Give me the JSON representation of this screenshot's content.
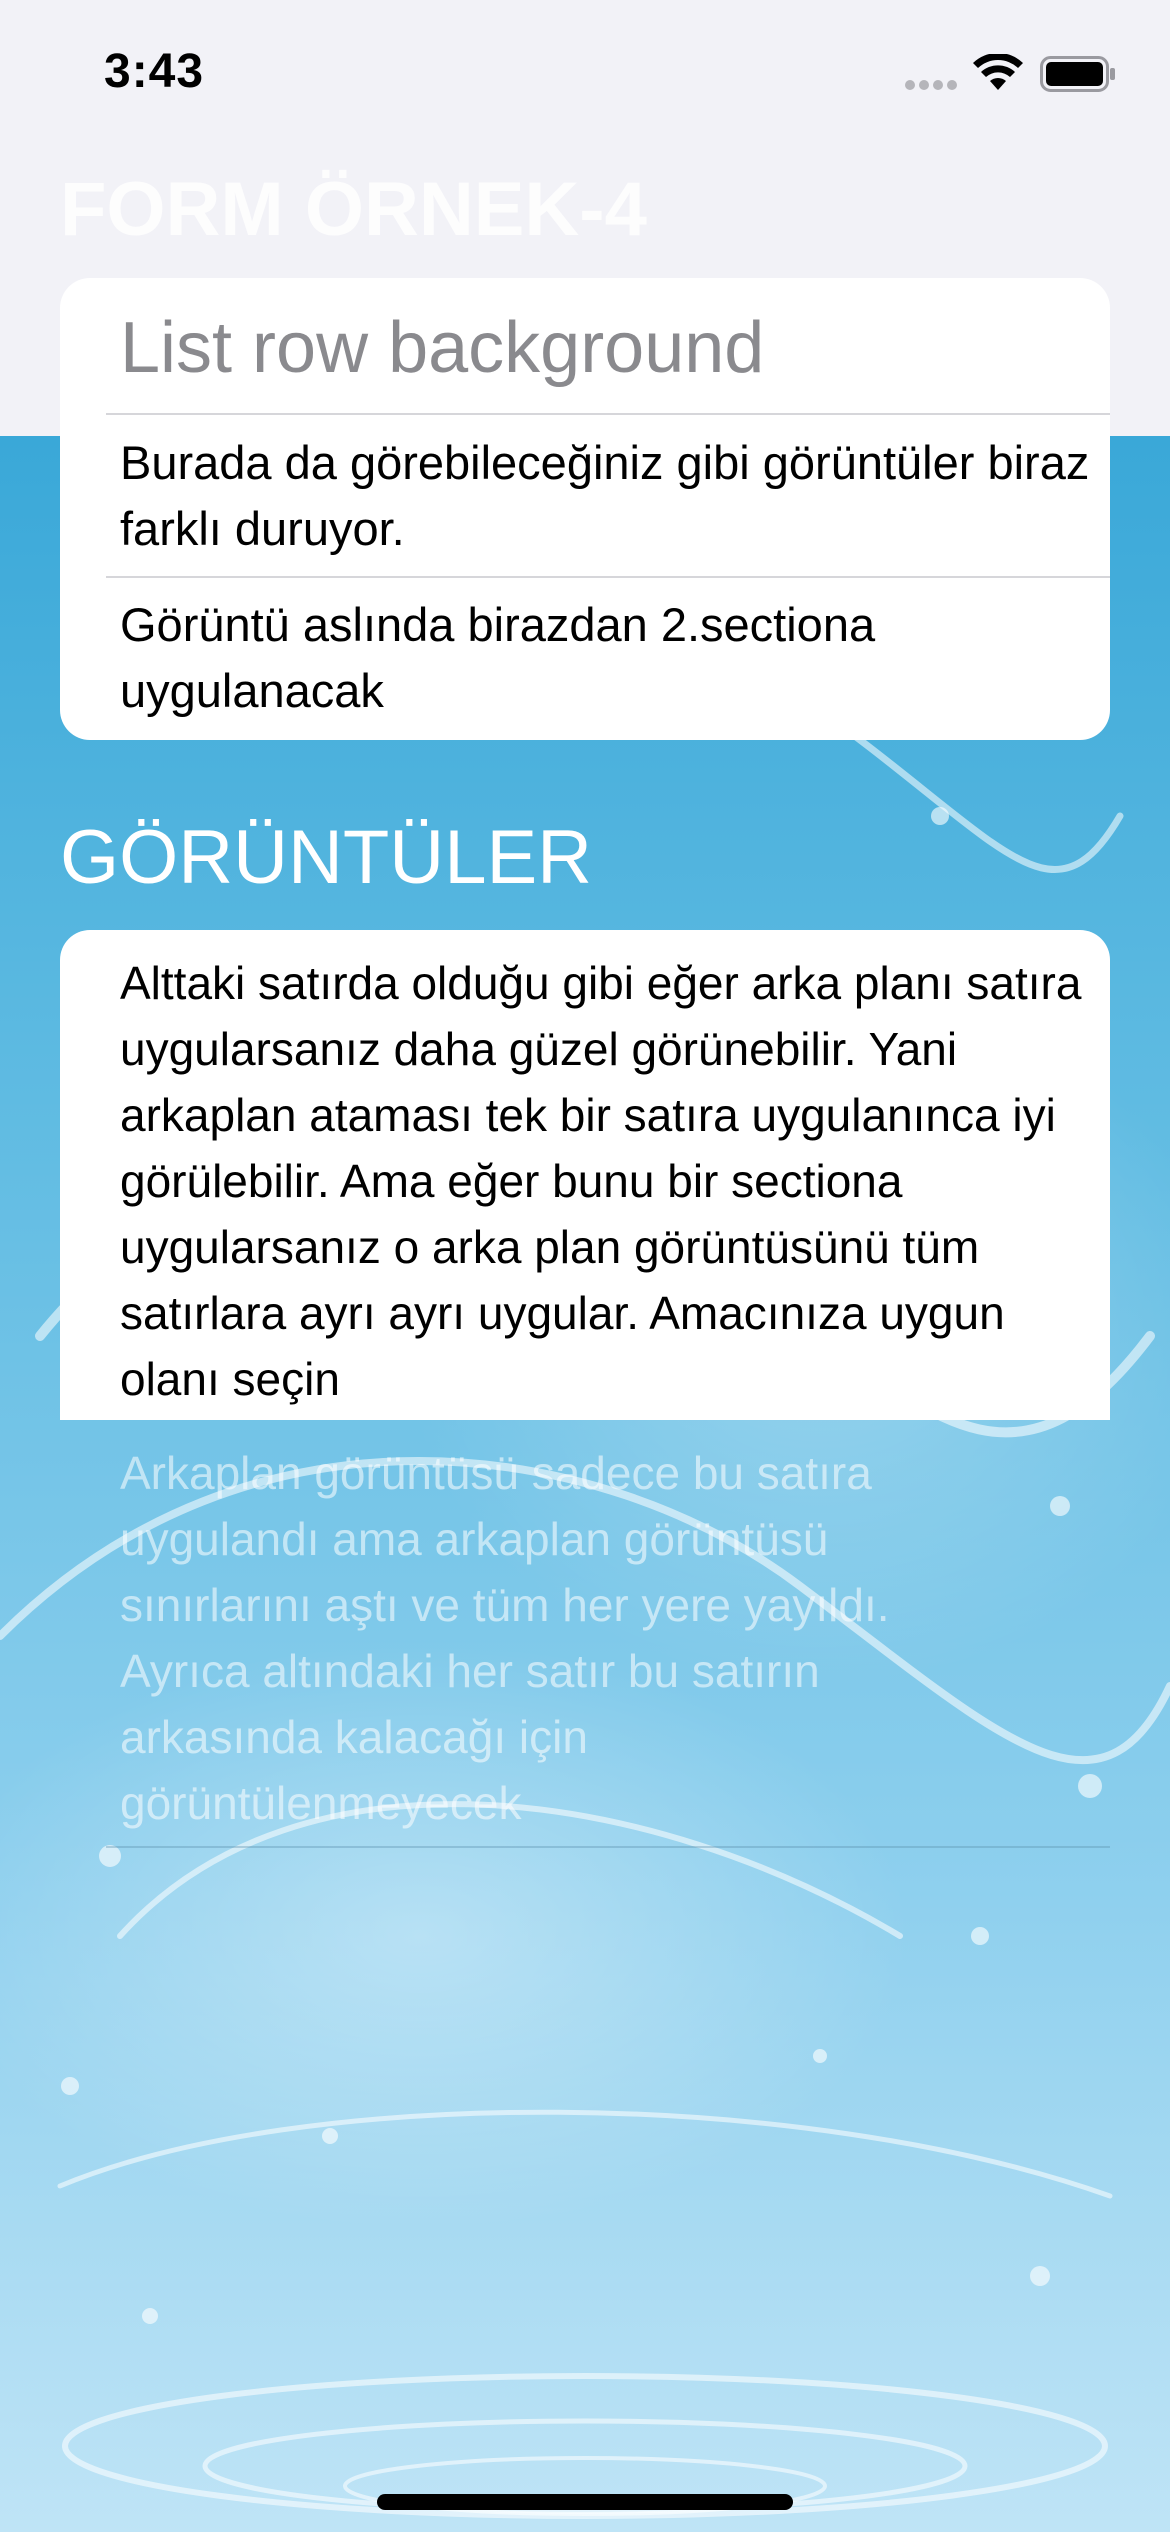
{
  "status_bar": {
    "time": "3:43"
  },
  "nav": {
    "title": "FORM ÖRNEK-4"
  },
  "section1": {
    "rows": [
      "List row background",
      "Burada da görebileceğiniz gibi görüntüler biraz farklı duruyor.",
      "Görüntü aslında birazdan 2.sectiona uygulanacak"
    ]
  },
  "section2": {
    "header": "GÖRÜNTÜLER",
    "rows": [
      "Alttaki satırda olduğu gibi eğer arka planı satıra uygularsanız daha güzel görünebilir. Yani arkaplan ataması tek bir satıra uygulanınca iyi görülebilir. Ama eğer bunu bir sectiona uygularsanız o arka plan görüntüsünü tüm satırlara ayrı ayrı uygular. Amacınıza uygun olanı seçin",
      "Arkaplan görüntüsü sadece bu satıra uygulandı ama arkaplan görüntüsü sınırlarını aştı ve tüm her yere yayıldı. Ayrıca altındaki her satır bu satırın arkasında kalacağı için görüntülenmeyecek"
    ]
  },
  "colors": {
    "background": "#f2f2f7",
    "water_top": "#3aa8d8",
    "water_bottom": "#bfe4f6",
    "card": "#ffffff",
    "title_text": "#ffffff"
  },
  "icons": [
    "signal-icon",
    "wifi-icon",
    "battery-icon"
  ]
}
